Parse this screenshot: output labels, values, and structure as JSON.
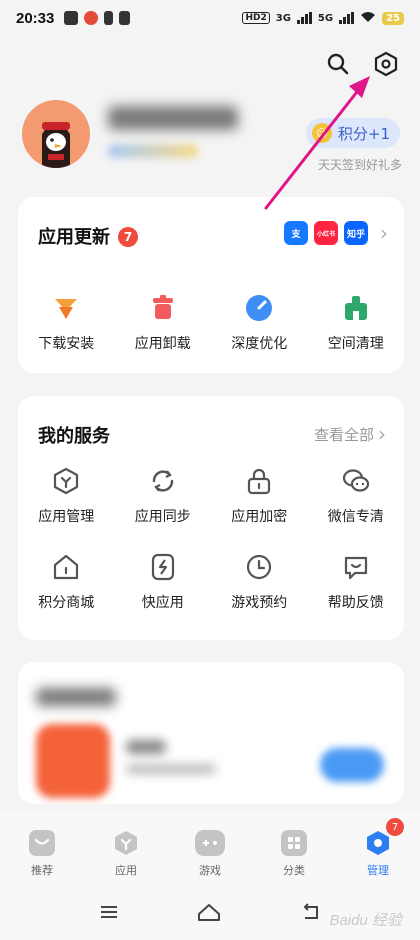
{
  "status_bar": {
    "time": "20:33",
    "hd": "HD2",
    "net1": "3G",
    "net2": "5G",
    "battery": "25"
  },
  "header": {
    "search_icon": "search-icon",
    "settings_icon": "settings-hexagon-icon"
  },
  "profile": {
    "points_label": "积分+1",
    "points_hint": "天天签到好礼多"
  },
  "app_update": {
    "title": "应用更新",
    "count": "7",
    "app_icons": [
      {
        "label": "支",
        "color": "#1677ff"
      },
      {
        "label": "小红书",
        "color": "#ff2442"
      },
      {
        "label": "知乎",
        "color": "#0a66ff"
      }
    ],
    "tools": [
      {
        "label": "下载安装",
        "icon": "download-install-icon",
        "color": "#f5a03a"
      },
      {
        "label": "应用卸载",
        "icon": "uninstall-trash-icon",
        "color": "#f25c5c"
      },
      {
        "label": "深度优化",
        "icon": "optimize-gauge-icon",
        "color": "#3d8ef5"
      },
      {
        "label": "空间清理",
        "icon": "clean-broom-icon",
        "color": "#2ea86a"
      }
    ]
  },
  "services": {
    "title": "我的服务",
    "see_all": "查看全部",
    "items": [
      {
        "label": "应用管理",
        "icon": "app-manage-icon"
      },
      {
        "label": "应用同步",
        "icon": "sync-icon"
      },
      {
        "label": "应用加密",
        "icon": "lock-icon"
      },
      {
        "label": "微信专清",
        "icon": "wechat-clean-icon"
      },
      {
        "label": "积分商城",
        "icon": "points-mall-icon"
      },
      {
        "label": "快应用",
        "icon": "quick-app-icon"
      },
      {
        "label": "游戏预约",
        "icon": "clock-icon"
      },
      {
        "label": "帮助反馈",
        "icon": "feedback-icon"
      }
    ]
  },
  "bottom_nav": {
    "items": [
      {
        "label": "推荐",
        "icon": "recommend-icon"
      },
      {
        "label": "应用",
        "icon": "apps-icon"
      },
      {
        "label": "游戏",
        "icon": "gamepad-icon"
      },
      {
        "label": "分类",
        "icon": "category-icon"
      },
      {
        "label": "管理",
        "icon": "manage-icon"
      }
    ],
    "active_index": 4,
    "manage_badge": "7"
  },
  "colors": {
    "accent": "#2d7ef0",
    "badge": "#f04c3e",
    "arrow": "#e0158a"
  },
  "watermark": "Baidu 经验"
}
